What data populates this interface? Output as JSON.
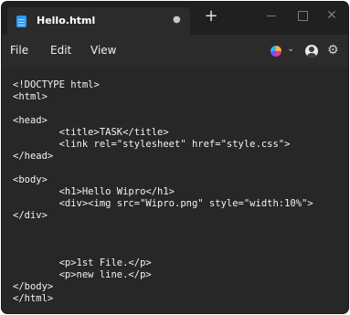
{
  "window": {
    "tab_title": "Hello.html",
    "tab_modified_indicator": "●",
    "new_tab_symbol": "+",
    "close_symbol": "✕",
    "icon": "notepad-icon"
  },
  "menu": {
    "file": "File",
    "edit": "Edit",
    "view": "View",
    "chevron": "⌄",
    "settings_glyph": "⚙"
  },
  "editor": {
    "lines": [
      "<!DOCTYPE html>",
      "<html>",
      "",
      "<head>",
      "        <title>TASK</title>",
      "        <link rel=\"stylesheet\" href=\"style.css\">",
      "</head>",
      "",
      "<body>",
      "        <h1>Hello Wipro</h1>",
      "        <div><img src=\"Wipro.png\" style=\"width:10%\">",
      "</div>",
      "",
      "",
      "        <p>1st File.</p>",
      "        <p>new line.</p>",
      "</body>",
      "</html>"
    ]
  },
  "colors": {
    "titlebar_bg": "#202020",
    "tab_bg": "#2b2b2b",
    "menubar_bg": "#2b2b2b",
    "editor_bg": "#272727",
    "text": "#f2f2f2",
    "app_icon_blue": "#2e9bf0"
  }
}
